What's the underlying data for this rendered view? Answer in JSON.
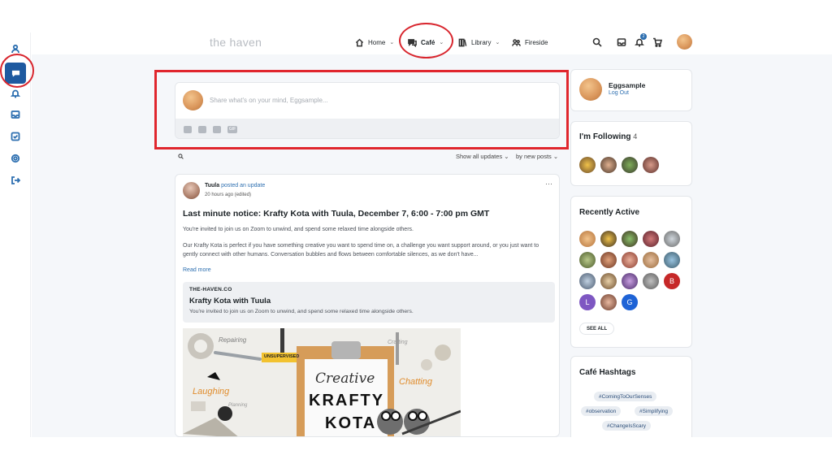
{
  "header": {
    "brand": "the haven",
    "nav": [
      {
        "label": "Home",
        "icon": "home-icon"
      },
      {
        "label": "Café",
        "icon": "chat-icon"
      },
      {
        "label": "Library",
        "icon": "library-icon"
      },
      {
        "label": "Fireside",
        "icon": "people-icon"
      }
    ],
    "notification_count": "2"
  },
  "sidebar": {
    "items": [
      "profile-icon",
      "cafe-icon",
      "bell-icon",
      "inbox-icon",
      "tasks-icon",
      "settings-icon",
      "logout-icon"
    ]
  },
  "composer": {
    "placeholder": "Share what's on your mind, Eggsample..."
  },
  "filters": {
    "show": "Show all updates",
    "sort": "by new posts"
  },
  "post": {
    "author": "Tuula",
    "action": "posted an update",
    "time": "20 hours ago",
    "edited": "(edited)",
    "title": "Last minute notice: Krafty Kota with Tuula, December 7, 6:00 - 7:00 pm GMT",
    "body1": "You're invited to join us on Zoom to unwind, and spend some relaxed time alongside others.",
    "body2": "Our Krafty Kota is perfect if you have something creative you want to spend time on, a challenge you want support around, or you just want to gently connect with other humans. Conversation bubbles and flows between comfortable silences, as we don't have...",
    "read_more": "Read more",
    "link_card": {
      "domain": "THE-HAVEN.CO",
      "title": "Krafty Kota with Tuula",
      "desc": "You're invited to join us on Zoom to unwind, and spend some relaxed time alongside others."
    },
    "image_words": {
      "repairing": "Repairing",
      "unsupervised": "UNSUPERVISED",
      "crafting": "Crafting",
      "creative": "Creative",
      "laughing": "Laughing",
      "planning": "Planning",
      "chatting": "Chatting",
      "krafty": "KRAFTY",
      "kota": "KOTA"
    }
  },
  "profile": {
    "name": "Eggsample",
    "logout": "Log Out"
  },
  "following": {
    "title": "I'm Following",
    "count": "4"
  },
  "recently_active": {
    "title": "Recently Active",
    "letters": [
      "B",
      "L",
      "G"
    ],
    "see_all": "SEE ALL"
  },
  "hashtags": {
    "title": "Café Hashtags",
    "tags": [
      "#ComingToOurSenses",
      "#observation",
      "#Simplifying",
      "#ChangeIsScary"
    ]
  },
  "colors": {
    "accent": "#2d6fb0",
    "highlight": "#e0262d",
    "letter_b": "#c62828",
    "letter_l": "#7e57c2",
    "letter_g": "#1e63d6"
  }
}
